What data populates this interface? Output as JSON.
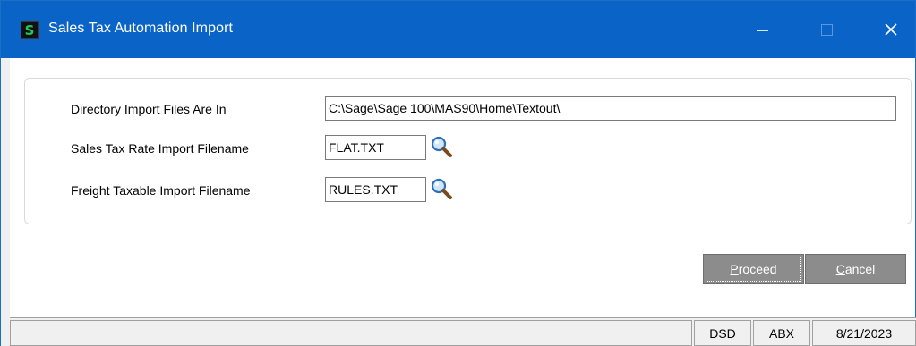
{
  "window": {
    "title": "Sales Tax Automation Import",
    "app_icon_glyph": "S",
    "controls": {
      "minimize": "minimize-icon",
      "maximize": "maximize-icon",
      "close": "close-icon"
    }
  },
  "form": {
    "directory": {
      "label": "Directory Import Files Are In",
      "value": "C:\\Sage\\Sage 100\\MAS90\\Home\\Textout\\"
    },
    "rate_file": {
      "label": "Sales Tax Rate Import Filename",
      "value": "FLAT.TXT",
      "lookup_icon": "magnifier-icon"
    },
    "freight_file": {
      "label": "Freight Taxable Import Filename",
      "value": "RULES.TXT",
      "lookup_icon": "magnifier-icon"
    }
  },
  "buttons": {
    "proceed": {
      "label_hot": "P",
      "label_rest": "roceed"
    },
    "cancel": {
      "label_hot": "C",
      "label_rest": "ancel"
    }
  },
  "status": {
    "company": "DSD",
    "user": "ABX",
    "date": "8/21/2023"
  },
  "colors": {
    "titlebar": "#0a64c8",
    "button": "#8c8c8c",
    "app_icon_letter": "#22c55e"
  }
}
